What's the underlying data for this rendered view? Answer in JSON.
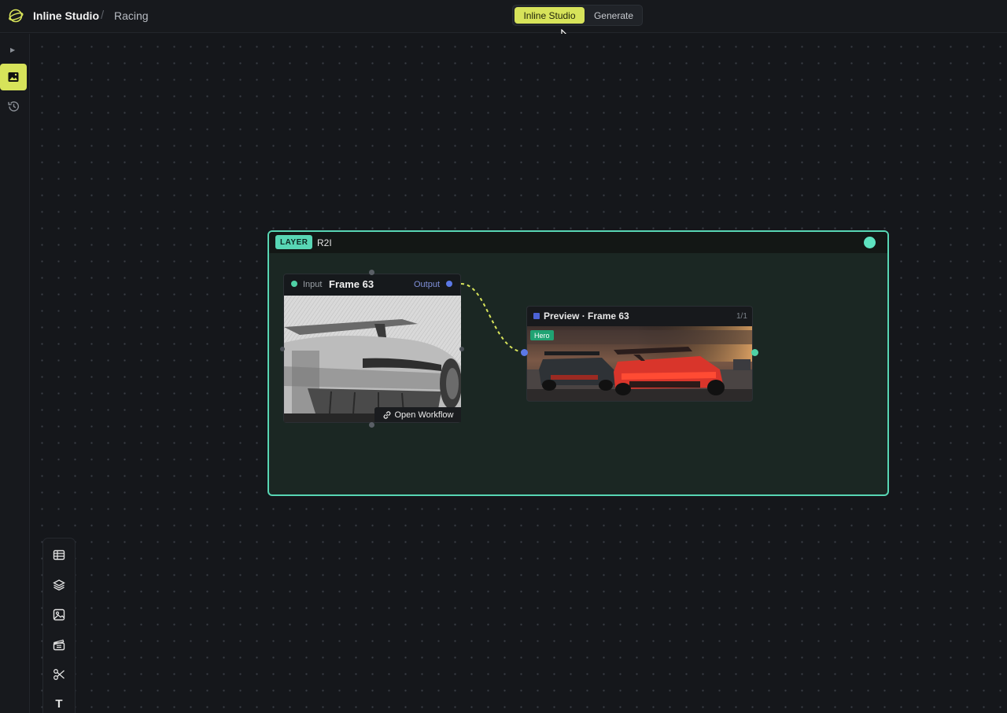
{
  "header": {
    "app_title": "Inline Studio",
    "breadcrumb_separator": "/",
    "breadcrumb": "Racing",
    "mode_toggle": {
      "active": "Inline Studio",
      "inactive": "Generate"
    }
  },
  "rail": {
    "items": [
      "expand-icon",
      "image-icon",
      "history-icon"
    ],
    "active_item": "image-icon"
  },
  "palette": {
    "tools": [
      "table-icon",
      "layers-icon",
      "image-icon",
      "clapperboard-icon",
      "scissors-icon",
      "text-tool"
    ],
    "text_tool_label": "T"
  },
  "layer": {
    "badge": "LAYER",
    "name": "R2I",
    "accent_color": "#58d6b4"
  },
  "input_node": {
    "input_label": "Input",
    "title": "Frame 63",
    "output_label": "Output",
    "action": "Open Workflow"
  },
  "preview_node": {
    "title": "Preview · Frame 63",
    "count": "1/1",
    "badge": "Hero"
  },
  "colors": {
    "accent_yellow": "#d7e35a",
    "teal": "#4fd1a6",
    "blue_port": "#5b78e6"
  }
}
